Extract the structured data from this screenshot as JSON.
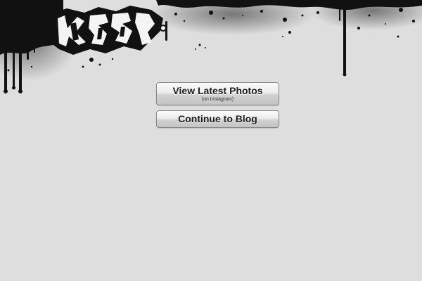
{
  "buttons": {
    "photos": {
      "label": "View Latest Photos",
      "sublabel": "(on Instagram)"
    },
    "blog": {
      "label": "Continue to Blog"
    }
  },
  "colors": {
    "background": "#dedede",
    "ink": "#111111",
    "button_text": "#1e1e1e"
  },
  "header": {
    "art": "graffiti-ink-splatter"
  }
}
